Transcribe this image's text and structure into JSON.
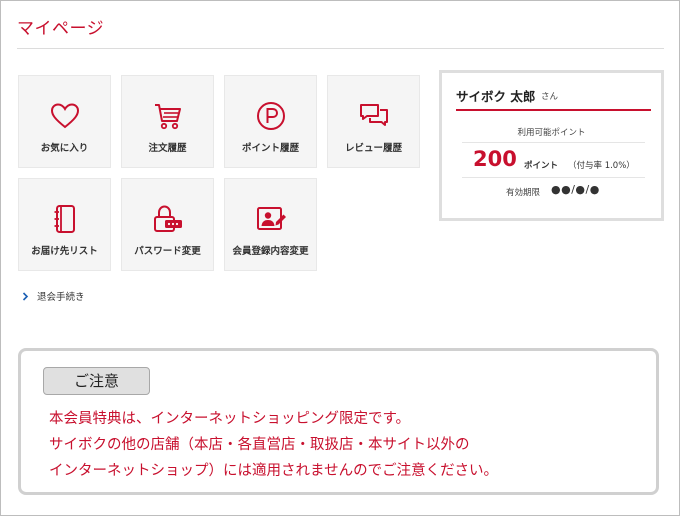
{
  "page_title": "マイページ",
  "menu": {
    "tiles": [
      {
        "label": "お気に入り",
        "icon": "heart-icon"
      },
      {
        "label": "注文履歴",
        "icon": "cart-icon"
      },
      {
        "label": "ポイント履歴",
        "icon": "point-icon"
      },
      {
        "label": "レビュー履歴",
        "icon": "review-icon"
      },
      {
        "label": "お届け先リスト",
        "icon": "address-book-icon"
      },
      {
        "label": "パスワード変更",
        "icon": "password-lock-icon"
      },
      {
        "label": "会員登録内容変更",
        "icon": "member-edit-icon"
      }
    ],
    "withdraw_label": "退会手続き"
  },
  "points_panel": {
    "user_name": "サイボク 太郎",
    "name_suffix": "さん",
    "available_label": "利用可能ポイント",
    "points_value": "200",
    "points_unit": "ポイント",
    "rate_text": "（付与率 1.0%）",
    "expiry_label": "有効期限",
    "expiry_value": "●●/●/●"
  },
  "notice": {
    "badge": "ご注意",
    "lines": [
      "本会員特典は、インターネットショッピング限定です。",
      "サイボクの他の店舗（本店・各直営店・取扱店・本サイト以外の",
      "インターネットショップ）には適用されませんのでご注意ください。"
    ]
  },
  "colors": {
    "accent": "#c8102e",
    "tile_bg": "#f5f5f5",
    "border": "#dedede"
  }
}
